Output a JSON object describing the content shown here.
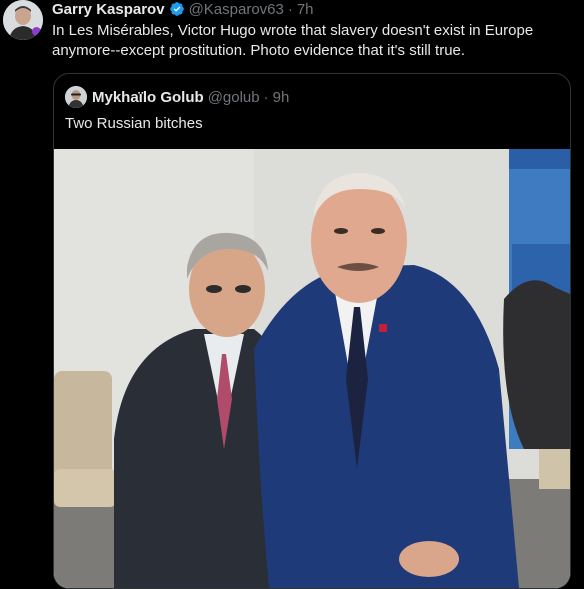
{
  "tweet": {
    "author_name": "Garry Kasparov",
    "author_handle": "@Kasparov63",
    "separator": "·",
    "time": "7h",
    "text": "In Les Misérables, Victor Hugo wrote that slavery doesn't exist in Europe anymore--except prostitution. Photo evidence that it's still true."
  },
  "quoted": {
    "author_name": "Mykhaïlo Golub",
    "author_handle": "@golub",
    "separator": "·",
    "time": "9h",
    "text": "Two Russian bitches"
  },
  "colors": {
    "background": "#000000",
    "text_primary": "#e7e9ea",
    "text_secondary": "#71767b",
    "verified_badge": "#1d9bf0",
    "border": "#2f3336"
  },
  "icons": [
    "verified-badge-icon"
  ]
}
